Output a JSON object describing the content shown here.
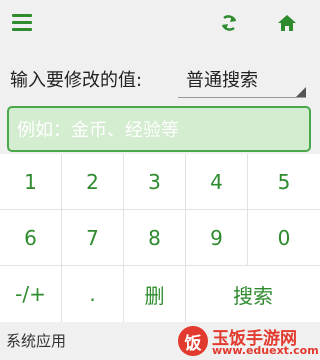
{
  "topbar": {
    "menu_icon": "menu-icon",
    "refresh_icon": "refresh-icon",
    "home_icon": "home-icon"
  },
  "form": {
    "label": "输入要修改的值:",
    "search_type": "普通搜索",
    "input_value": "",
    "input_placeholder": "例如：金币、经验等"
  },
  "keypad": {
    "rows": [
      [
        "1",
        "2",
        "3",
        "4",
        "5"
      ],
      [
        "6",
        "7",
        "8",
        "9",
        "0"
      ],
      [
        "-/+",
        ".",
        "删",
        "搜索"
      ]
    ]
  },
  "footer": {
    "label": "系统应用",
    "watermark_logo": "饭",
    "watermark_title": "玉饭手游网",
    "watermark_url": "www.eduext.com"
  },
  "colors": {
    "accent": "#2e8b2e",
    "input_bg": "#d4ecd0",
    "input_border": "#4aa84a",
    "watermark": "#e23a2e"
  }
}
